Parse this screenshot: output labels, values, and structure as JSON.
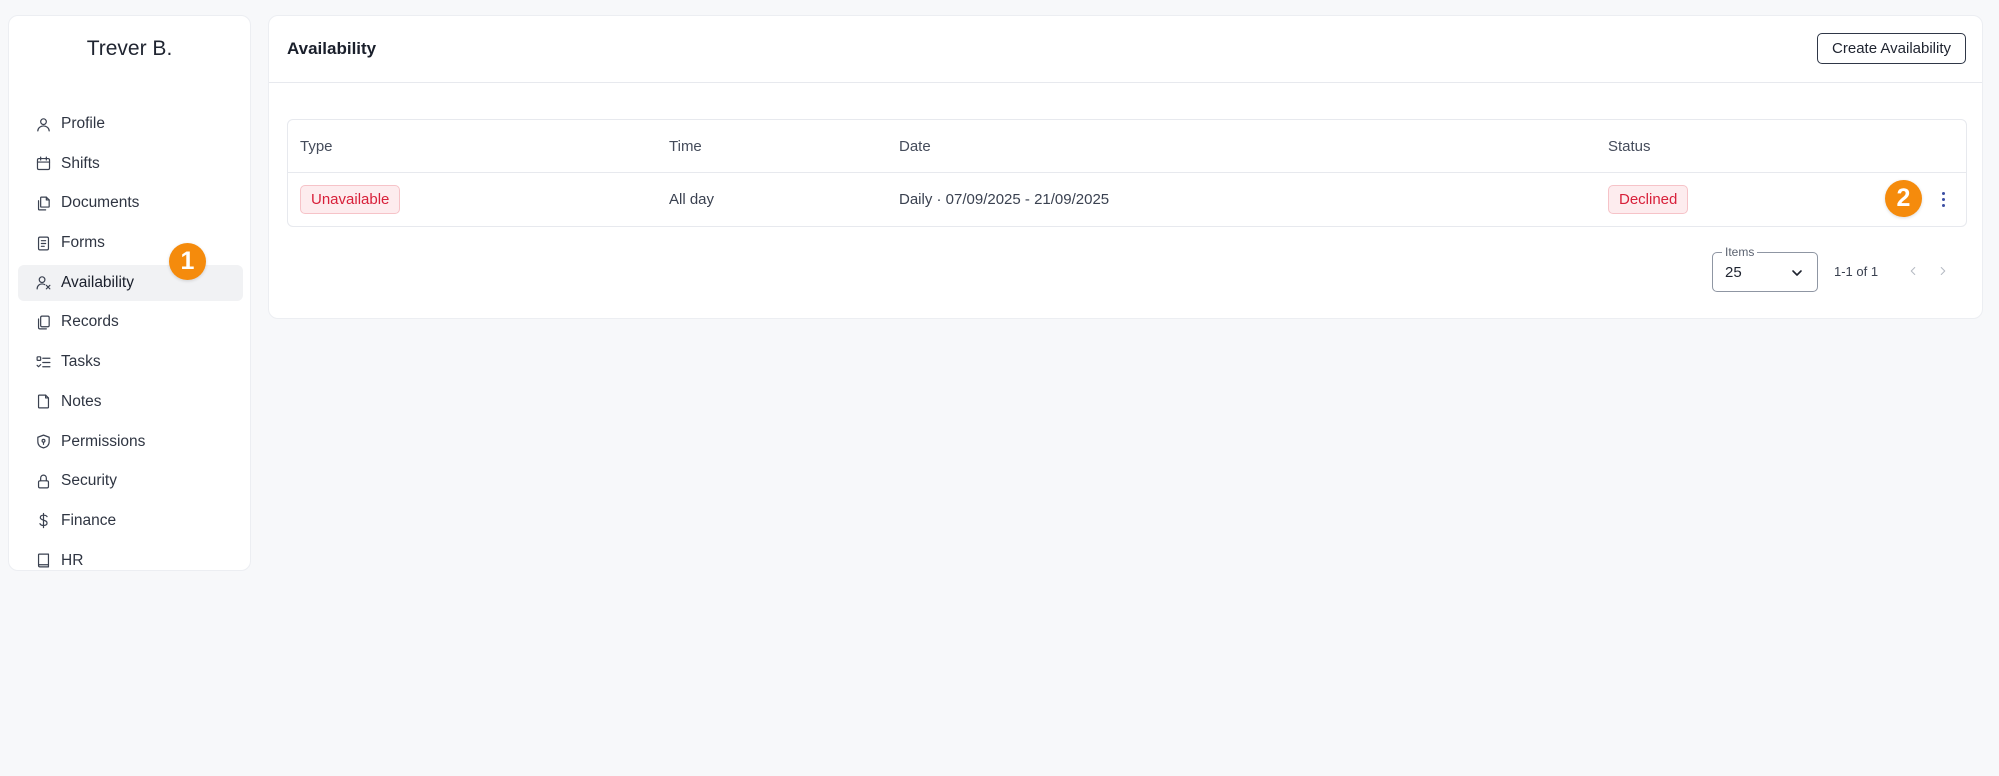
{
  "sidebar": {
    "user_name": "Trever B.",
    "items": [
      {
        "label": "Profile",
        "icon": "user-icon"
      },
      {
        "label": "Shifts",
        "icon": "calendar-icon"
      },
      {
        "label": "Documents",
        "icon": "documents-icon"
      },
      {
        "label": "Forms",
        "icon": "form-icon"
      },
      {
        "label": "Availability",
        "icon": "user-x-icon",
        "active": true
      },
      {
        "label": "Records",
        "icon": "records-icon"
      },
      {
        "label": "Tasks",
        "icon": "tasks-icon"
      },
      {
        "label": "Notes",
        "icon": "note-icon"
      },
      {
        "label": "Permissions",
        "icon": "shield-icon"
      },
      {
        "label": "Security",
        "icon": "lock-icon"
      },
      {
        "label": "Finance",
        "icon": "dollar-icon"
      },
      {
        "label": "HR",
        "icon": "book-icon"
      }
    ]
  },
  "markers": {
    "one": "1",
    "two": "2"
  },
  "panel": {
    "title": "Availability",
    "create_button": "Create Availability",
    "table": {
      "columns": [
        "Type",
        "Time",
        "Date",
        "Status"
      ],
      "rows": [
        {
          "type": "Unavailable",
          "time": "All day",
          "date": "Daily · 07/09/2025 - 21/09/2025",
          "status": "Declined"
        }
      ]
    },
    "pagination": {
      "items_label": "Items",
      "page_size": "25",
      "range": "1-1 of 1"
    }
  },
  "colors": {
    "accent_marker": "#f58b0c",
    "badge_red": "#d8203a",
    "kebab_blue": "#3b4ea3"
  }
}
